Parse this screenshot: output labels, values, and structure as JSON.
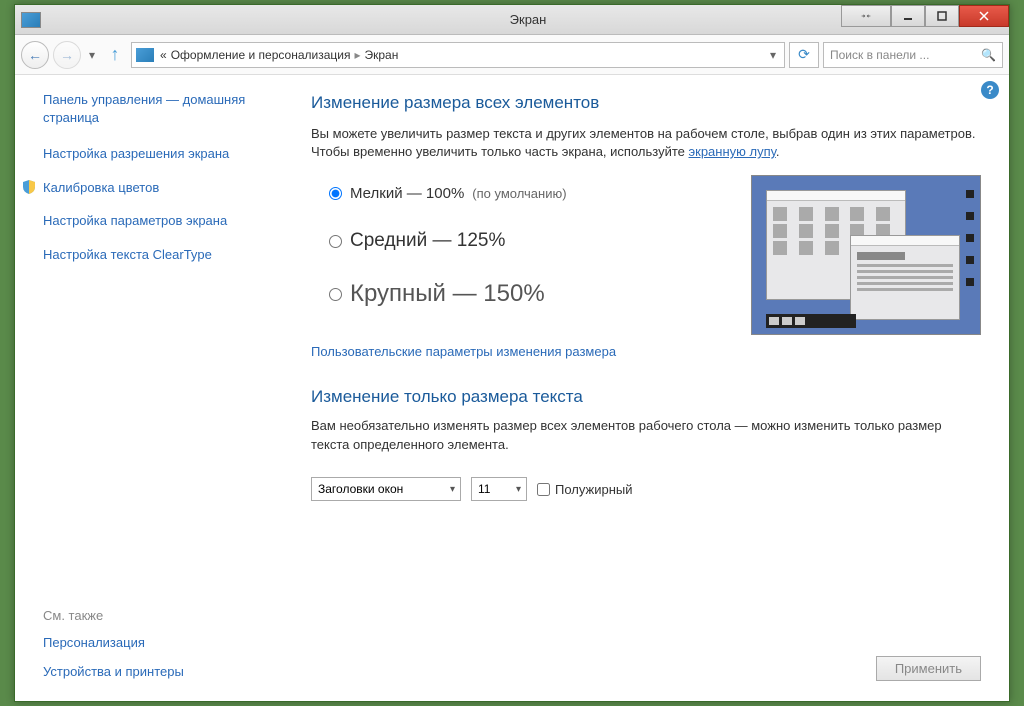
{
  "window": {
    "title": "Экран"
  },
  "breadcrumb": {
    "parent": "Оформление и персонализация",
    "current": "Экран",
    "chevron": "«"
  },
  "search": {
    "placeholder": "Поиск в панели ..."
  },
  "sidebar": {
    "home": "Панель управления — домашняя страница",
    "links": [
      {
        "label": "Настройка разрешения экрана"
      },
      {
        "label": "Калибровка цветов",
        "shield": true
      },
      {
        "label": "Настройка параметров экрана"
      },
      {
        "label": "Настройка текста ClearType"
      }
    ],
    "seealso": "См. также",
    "bottom": [
      {
        "label": "Персонализация"
      },
      {
        "label": "Устройства и принтеры"
      }
    ]
  },
  "main": {
    "heading1": "Изменение размера всех элементов",
    "desc1_a": "Вы можете увеличить размер текста и других элементов на рабочем столе, выбрав один из этих параметров. Чтобы временно увеличить только часть экрана, используйте ",
    "desc1_link": "экранную лупу",
    "desc1_b": ".",
    "radios": [
      {
        "label": "Мелкий — 100%",
        "default": "(по умолчанию)",
        "checked": true
      },
      {
        "label": "Средний — 125%",
        "checked": false
      },
      {
        "label": "Крупный — 150%",
        "checked": false
      }
    ],
    "customlink": "Пользовательские параметры изменения размера",
    "heading2": "Изменение только размера текста",
    "desc2": "Вам необязательно изменять размер всех элементов рабочего стола — можно изменить только размер текста определенного элемента.",
    "element_select": "Заголовки окон",
    "size_select": "11",
    "bold_label": "Полужирный",
    "apply": "Применить"
  }
}
